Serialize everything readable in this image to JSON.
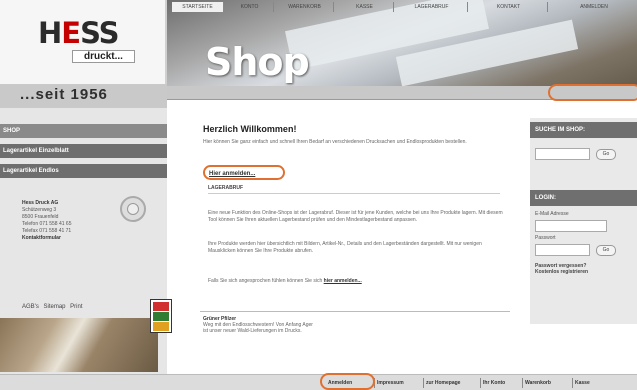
{
  "brand": {
    "logo_text_prefix": "H",
    "logo_text_accent": "E",
    "logo_text_suffix": "SS",
    "logo_sub": "druckt...",
    "tagline": "...seit 1956"
  },
  "header": {
    "title": "Shop"
  },
  "topnav": {
    "items": [
      {
        "label": "STARTSEITE"
      },
      {
        "label": "KONTO"
      },
      {
        "label": "WARENKORB"
      },
      {
        "label": "KASSE"
      },
      {
        "label": "LAGERABRUF"
      },
      {
        "label": "KONTAKT"
      },
      {
        "label": "ANMELDEN"
      }
    ]
  },
  "sidebar": {
    "items": [
      {
        "label": "SHOP"
      },
      {
        "label": "Lagerartikel Einzelblatt"
      },
      {
        "label": "Lagerartikel Endlos"
      }
    ],
    "address": {
      "company": "Hess Druck AG",
      "street": "Schützenweg 3",
      "city": "8500 Frauenfeld",
      "phone": "Telefon 071 558 41 65",
      "fax": "Telefax 071 558 41 71",
      "contact": "Kontaktformular"
    },
    "footer_links": "AGB's  Sitemap  Print"
  },
  "main": {
    "welcome": "Herzlich Willkommen!",
    "intro": "Hier können Sie ganz einfach und schnell Ihren Bedarf an verschiedenen Drucksachen und Endlosprodukten bestellen.",
    "login_link": "Hier anmelden...",
    "section_title": "LAGERABRUF",
    "p1": "Eine neue Funktion des Online-Shops ist der Lagerabruf. Dieser ist für jene Kunden, welche bei uns Ihre Produkte lagern. Mit diesem Tool können Sie Ihren aktuellen Lagerbestand prüfen und den Mindestlagerbestand anpassen.",
    "p2": "Ihre Produkte werden hier übersichtlich mit Bildern, Artikel-Nr., Details und den Lagerbeständen dargestellt. Mit nur wenigen Mausklicken können Sie Ihre Produkte abrufen.",
    "p3_prefix": "Falls Sie sich angesprochen fühlen können Sie sich",
    "p3_link": "hier anmelden...",
    "sig_name": "Grüner Pfilzer",
    "sig_line1": "Weg mit den Endlosschwestern! Von Anfang Ager",
    "sig_line2": "ist unser neuer Wald-Lieferungen im Drucks."
  },
  "right": {
    "search_title": "SUCHE IM SHOP:",
    "search_go": "Go",
    "login_title": "LOGIN:",
    "email_label": "E-Mail Adresse",
    "password_label": "Passwort",
    "login_go": "Go",
    "forgot": "Passwort vergessen?",
    "register": "Kostenlos registrieren"
  },
  "bottombar": {
    "items": [
      {
        "label": "Anmelden"
      },
      {
        "label": "Impressum"
      },
      {
        "label": "zur Homepage"
      },
      {
        "label": "Ihr Konto"
      },
      {
        "label": "Warenkorb"
      },
      {
        "label": "Kasse"
      }
    ]
  },
  "colors": {
    "highlight": "#e07030",
    "nav_dark": "#6e6e6e",
    "logo_accent": "#c40000"
  }
}
